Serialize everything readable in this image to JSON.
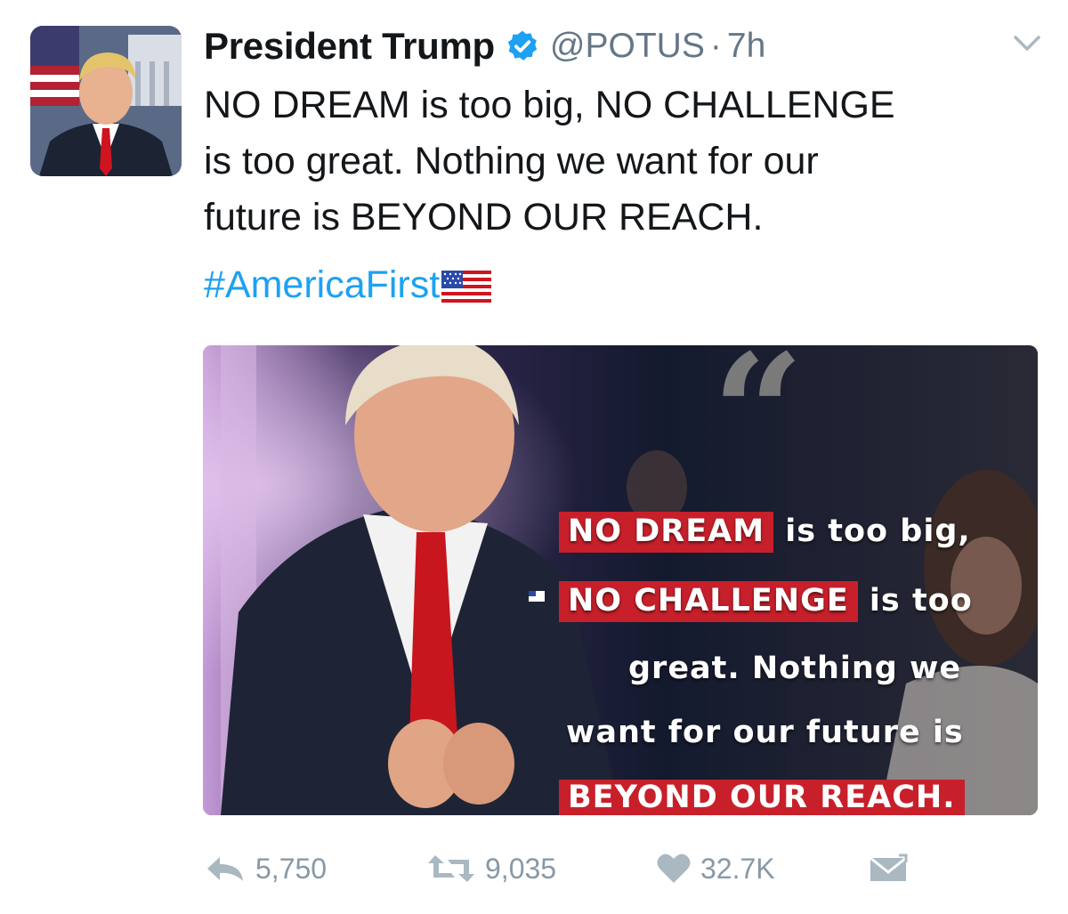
{
  "tweet": {
    "author_name": "President Trump",
    "handle": "@POTUS",
    "separator": "·",
    "time": "7h",
    "text_lines": [
      "NO DREAM is too big, NO CHALLENGE",
      "is too great. Nothing we want for our",
      "future is BEYOND OUR REACH."
    ],
    "hashtag": "#AmericaFirst",
    "media_quote": {
      "line1_highlight": "NO DREAM",
      "line1_rest": " is too big,",
      "line2_highlight": "NO CHALLENGE",
      "line2_rest": " is too",
      "line3": "great. Nothing we",
      "line4": "want for our future is",
      "line5_highlight": "BEYOND OUR REACH."
    },
    "actions": {
      "reply_count": "5,750",
      "retweet_count": "9,035",
      "like_count": "32.7K"
    }
  },
  "colors": {
    "link": "#1da1f2",
    "muted": "#657786",
    "action_gray": "#8899a6",
    "highlight_red": "#c8202b"
  },
  "icons": [
    "verified-badge-icon",
    "caret-down-icon",
    "us-flag-emoji-icon",
    "reply-icon",
    "retweet-icon",
    "heart-icon",
    "direct-message-icon"
  ]
}
